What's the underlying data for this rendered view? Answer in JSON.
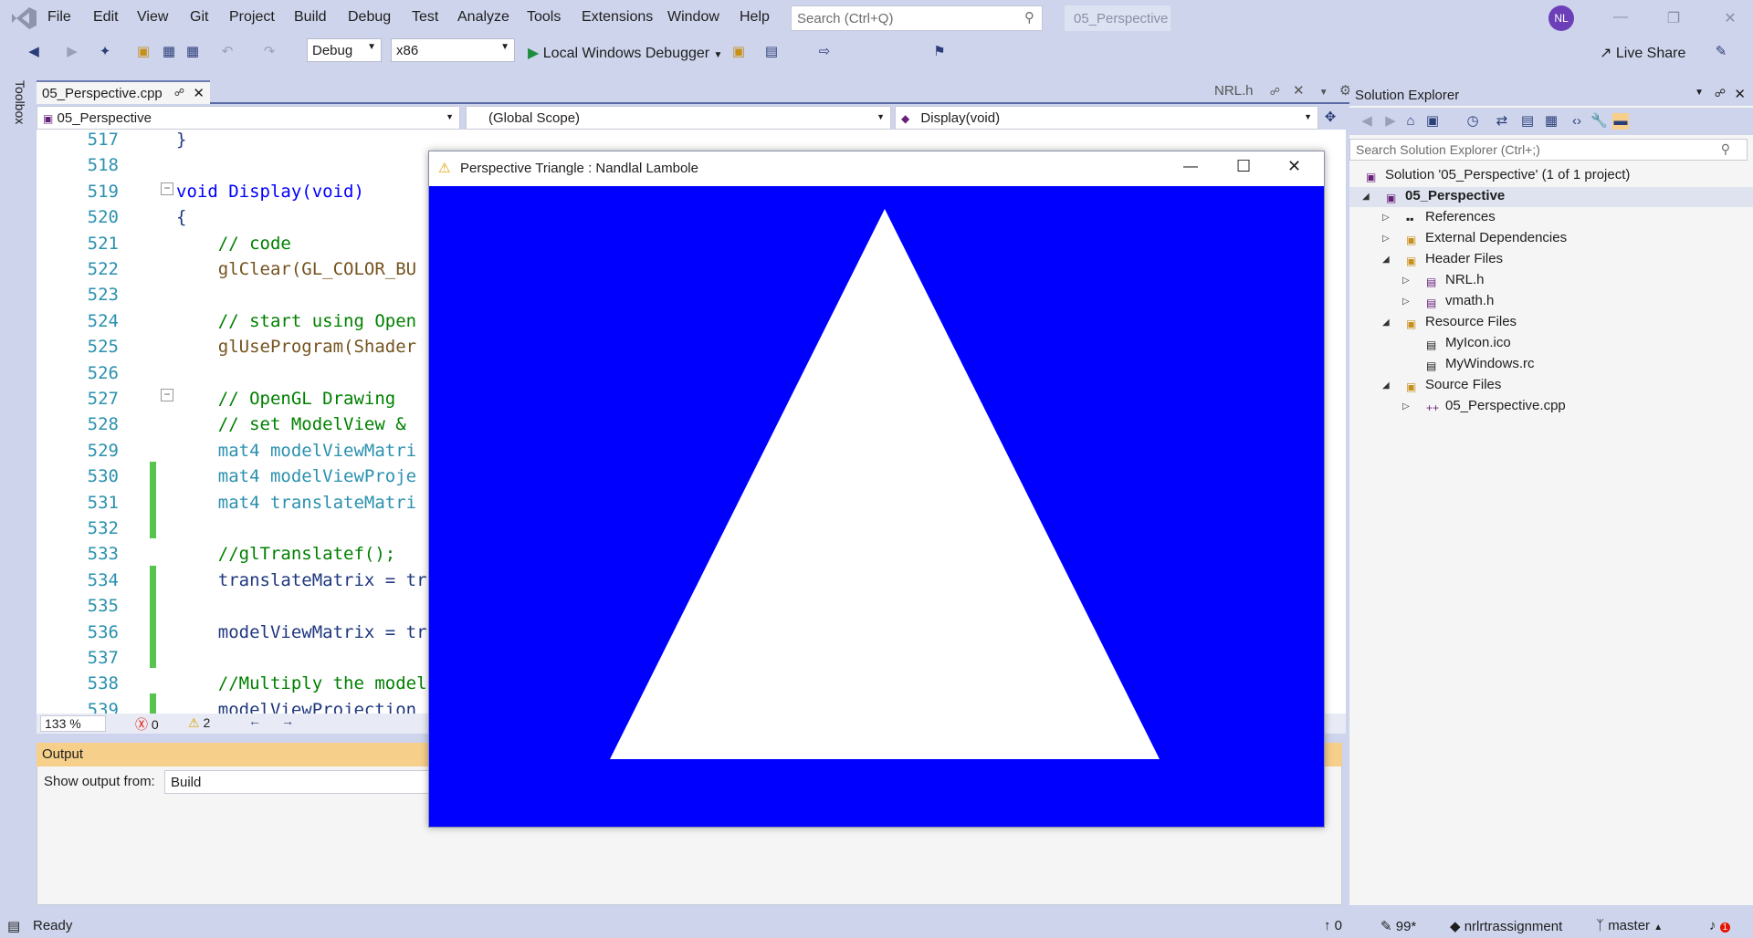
{
  "app": {
    "menu": [
      "File",
      "Edit",
      "View",
      "Git",
      "Project",
      "Build",
      "Debug",
      "Test",
      "Analyze",
      "Tools",
      "Extensions",
      "Window",
      "Help"
    ],
    "search_placeholder": "Search (Ctrl+Q)",
    "solution_name": "05_Perspective",
    "avatar_initials": "NL"
  },
  "toolbar": {
    "config": "Debug",
    "platform": "x86",
    "run_label": "Local Windows Debugger",
    "live_share": "Live Share"
  },
  "toolbox_label": "Toolbox",
  "editor": {
    "active_tab": "05_Perspective.cpp",
    "other_tab": "NRL.h",
    "nav_project": "05_Perspective",
    "nav_scope": "(Global Scope)",
    "nav_member": "Display(void)",
    "lines": [
      {
        "n": "517",
        "text": "}"
      },
      {
        "n": "518",
        "text": ""
      },
      {
        "n": "519",
        "text": "void Display(void)"
      },
      {
        "n": "520",
        "text": "{"
      },
      {
        "n": "521",
        "text": "    // code"
      },
      {
        "n": "522",
        "text": "    glClear(GL_COLOR_BU"
      },
      {
        "n": "523",
        "text": ""
      },
      {
        "n": "524",
        "text": "    // start using Open"
      },
      {
        "n": "525",
        "text": "    glUseProgram(Shader"
      },
      {
        "n": "526",
        "text": ""
      },
      {
        "n": "527",
        "text": "    // OpenGL Drawing"
      },
      {
        "n": "528",
        "text": "    // set ModelView & "
      },
      {
        "n": "529",
        "text": "    mat4 modelViewMatri"
      },
      {
        "n": "530",
        "text": "    mat4 modelViewProje"
      },
      {
        "n": "531",
        "text": "    mat4 translateMatri"
      },
      {
        "n": "532",
        "text": ""
      },
      {
        "n": "533",
        "text": "    //glTranslatef();"
      },
      {
        "n": "534",
        "text": "    translateMatrix = tr"
      },
      {
        "n": "535",
        "text": ""
      },
      {
        "n": "536",
        "text": "    modelViewMatrix = tr"
      },
      {
        "n": "537",
        "text": ""
      },
      {
        "n": "538",
        "text": "    //Multiply the model"
      },
      {
        "n": "539",
        "text": "    modelViewProjection"
      }
    ],
    "zoom": "133 %",
    "errors": "0",
    "warnings": "2"
  },
  "output": {
    "title": "Output",
    "show_from_label": "Show output from:",
    "source": "Build"
  },
  "solution_explorer": {
    "title": "Solution Explorer",
    "search_placeholder": "Search Solution Explorer (Ctrl+;)",
    "solution": "Solution '05_Perspective' (1 of 1 project)",
    "project": "05_Perspective",
    "references": "References",
    "external_deps": "External Dependencies",
    "header_files": "Header Files",
    "nrl_h": "NRL.h",
    "vmath_h": "vmath.h",
    "resource_files": "Resource Files",
    "myicon": "MyIcon.ico",
    "mywindows_rc": "MyWindows.rc",
    "source_files": "Source Files",
    "perspective_cpp": "05_Perspective.cpp"
  },
  "statusbar": {
    "ready": "Ready",
    "up_count": "0",
    "pencil_count": "99*",
    "repo": "nrlrtrassignment",
    "branch": "master",
    "notifications": "1"
  },
  "gl_window": {
    "title": "Perspective Triangle : Nandlal Lambole",
    "background_color": "#0000ff",
    "triangle_color": "#ffffff"
  }
}
